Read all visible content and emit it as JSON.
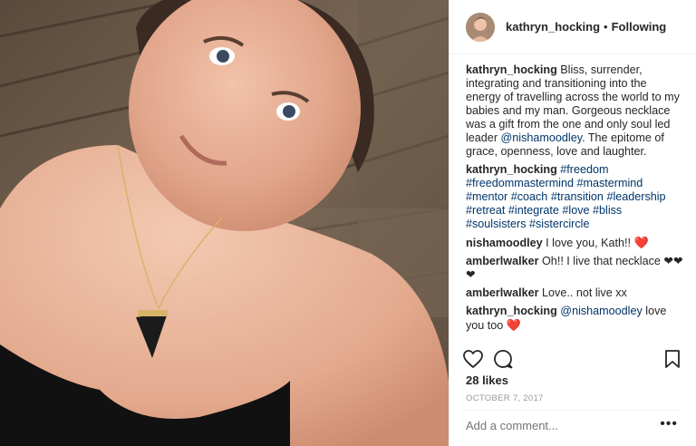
{
  "post": {
    "username": "kathryn_hocking",
    "separator": "•",
    "follow_status": "Following"
  },
  "comments": [
    {
      "user": "kathryn_hocking",
      "parts": [
        {
          "type": "text",
          "value": " Bliss, surrender, integrating and transitioning into the energy of travelling across the world to my babies and my man. Gorgeous necklace was a gift from the one and only soul led leader "
        },
        {
          "type": "tag",
          "value": "@nishamoodley"
        },
        {
          "type": "text",
          "value": ". The epitome of grace, openness, love and laughter."
        }
      ]
    },
    {
      "user": "kathryn_hocking",
      "parts": [
        {
          "type": "text",
          "value": " "
        },
        {
          "type": "tag",
          "value": "#freedom"
        },
        {
          "type": "text",
          "value": " "
        },
        {
          "type": "tag",
          "value": "#freedommastermind"
        },
        {
          "type": "text",
          "value": " "
        },
        {
          "type": "tag",
          "value": "#mastermind"
        },
        {
          "type": "text",
          "value": " "
        },
        {
          "type": "tag",
          "value": "#mentor"
        },
        {
          "type": "text",
          "value": " "
        },
        {
          "type": "tag",
          "value": "#coach"
        },
        {
          "type": "text",
          "value": " "
        },
        {
          "type": "tag",
          "value": "#transition"
        },
        {
          "type": "text",
          "value": " "
        },
        {
          "type": "tag",
          "value": "#leadership"
        },
        {
          "type": "text",
          "value": " "
        },
        {
          "type": "tag",
          "value": "#retreat"
        },
        {
          "type": "text",
          "value": " "
        },
        {
          "type": "tag",
          "value": "#integrate"
        },
        {
          "type": "text",
          "value": " "
        },
        {
          "type": "tag",
          "value": "#love"
        },
        {
          "type": "text",
          "value": " "
        },
        {
          "type": "tag",
          "value": "#bliss"
        },
        {
          "type": "text",
          "value": " "
        },
        {
          "type": "tag",
          "value": "#soulsisters"
        },
        {
          "type": "text",
          "value": " "
        },
        {
          "type": "tag",
          "value": "#sistercircle"
        }
      ]
    },
    {
      "user": "nishamoodley",
      "parts": [
        {
          "type": "text",
          "value": " I love you, Kath!! "
        },
        {
          "type": "heart",
          "value": "❤️"
        }
      ]
    },
    {
      "user": "amberlwalker",
      "parts": [
        {
          "type": "text",
          "value": " Oh!! I live that necklace ❤❤❤"
        }
      ]
    },
    {
      "user": "amberlwalker",
      "parts": [
        {
          "type": "text",
          "value": " Love.. not live xx"
        }
      ]
    },
    {
      "user": "kathryn_hocking",
      "parts": [
        {
          "type": "text",
          "value": " "
        },
        {
          "type": "tag",
          "value": "@nishamoodley"
        },
        {
          "type": "text",
          "value": " love you too "
        },
        {
          "type": "heart",
          "value": "❤️"
        }
      ]
    }
  ],
  "actions": {
    "like_icon": "heart-outline-icon",
    "comment_icon": "comment-bubble-icon",
    "save_icon": "bookmark-icon"
  },
  "likes_text": "28 likes",
  "date_text": "OCTOBER 7, 2017",
  "add_comment": {
    "placeholder": "Add a comment..."
  },
  "more_label": "•••",
  "colors": {
    "link": "#003569",
    "heart": "#ed4956",
    "muted": "#999999",
    "text": "#262626"
  }
}
